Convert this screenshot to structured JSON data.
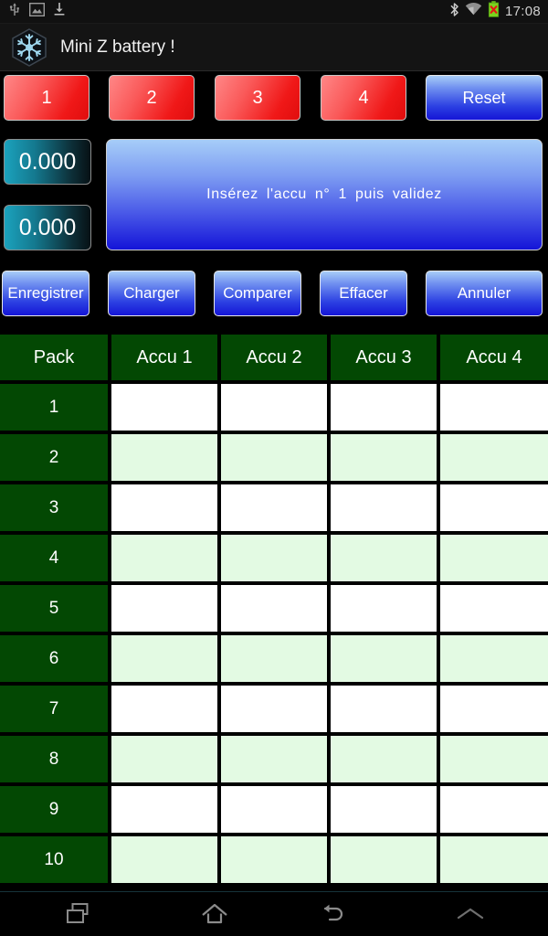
{
  "statusbar": {
    "left_icons": [
      "usb-icon",
      "screenshot-image-icon",
      "download-icon"
    ],
    "right_icons": [
      "bluetooth-icon",
      "wifi-icon",
      "battery-error-icon"
    ],
    "time": "17:08"
  },
  "titlebar": {
    "icon": "snowflake-icon",
    "title": "Mini Z battery !"
  },
  "colors": {
    "red_button": "#f01818",
    "blue_button": "#2b3fe2",
    "table_header_green": "#034803",
    "row_mint": "#e3fae3",
    "value_cyan": "#1ba2bd"
  },
  "cell_buttons": {
    "items": [
      {
        "label": "1",
        "name": "cell-button-1"
      },
      {
        "label": "2",
        "name": "cell-button-2"
      },
      {
        "label": "3",
        "name": "cell-button-3"
      },
      {
        "label": "4",
        "name": "cell-button-4"
      }
    ],
    "reset_label": "Reset"
  },
  "readouts": {
    "value_1": "0.000",
    "value_2": "0.000"
  },
  "message": {
    "text": "Insérez l'accu n°  1  puis validez"
  },
  "actions": {
    "items": [
      {
        "label": "Enregistrer",
        "name": "save-button"
      },
      {
        "label": "Charger",
        "name": "load-button"
      },
      {
        "label": "Comparer",
        "name": "compare-button"
      },
      {
        "label": "Effacer",
        "name": "erase-button"
      },
      {
        "label": "Annuler",
        "name": "cancel-button"
      }
    ]
  },
  "table": {
    "headers": [
      "Pack",
      "Accu 1",
      "Accu 2",
      "Accu 3",
      "Accu 4"
    ],
    "rows": [
      {
        "pack": "1",
        "cells": [
          "",
          "",
          "",
          ""
        ]
      },
      {
        "pack": "2",
        "cells": [
          "",
          "",
          "",
          ""
        ]
      },
      {
        "pack": "3",
        "cells": [
          "",
          "",
          "",
          ""
        ]
      },
      {
        "pack": "4",
        "cells": [
          "",
          "",
          "",
          ""
        ]
      },
      {
        "pack": "5",
        "cells": [
          "",
          "",
          "",
          ""
        ]
      },
      {
        "pack": "6",
        "cells": [
          "",
          "",
          "",
          ""
        ]
      },
      {
        "pack": "7",
        "cells": [
          "",
          "",
          "",
          ""
        ]
      },
      {
        "pack": "8",
        "cells": [
          "",
          "",
          "",
          ""
        ]
      },
      {
        "pack": "9",
        "cells": [
          "",
          "",
          "",
          ""
        ]
      },
      {
        "pack": "10",
        "cells": [
          "",
          "",
          "",
          ""
        ]
      }
    ]
  },
  "navbar": {
    "items": [
      {
        "name": "recent-apps-icon"
      },
      {
        "name": "home-icon"
      },
      {
        "name": "back-icon"
      },
      {
        "name": "chevron-up-icon"
      }
    ]
  }
}
